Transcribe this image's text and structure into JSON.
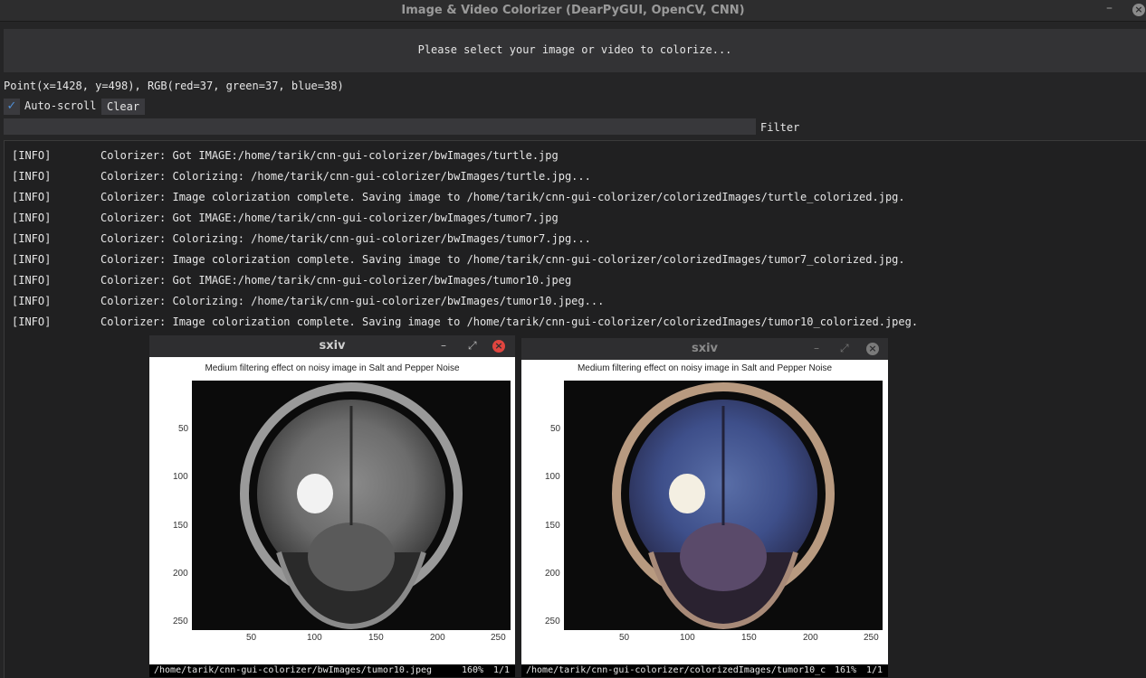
{
  "app": {
    "title": "Image & Video Colorizer (DearPyGUI, OpenCV, CNN)",
    "minimize": "–",
    "close": "×"
  },
  "banner": {
    "text": "Please select your image or video to colorize..."
  },
  "point_info": "Point(x=1428, y=498), RGB(red=37, green=37, blue=38)",
  "controls": {
    "autoscroll_checked": "✓",
    "autoscroll_label": "Auto-scroll",
    "clear_label": "Clear",
    "filter_label": "Filter",
    "filter_value": ""
  },
  "log": [
    {
      "level": "[INFO]",
      "msg": "Colorizer: Got IMAGE:/home/tarik/cnn-gui-colorizer/bwImages/turtle.jpg"
    },
    {
      "level": "[INFO]",
      "msg": "Colorizer: Colorizing: /home/tarik/cnn-gui-colorizer/bwImages/turtle.jpg..."
    },
    {
      "level": "[INFO]",
      "msg": "Colorizer: Image colorization complete. Saving image to /home/tarik/cnn-gui-colorizer/colorizedImages/turtle_colorized.jpg."
    },
    {
      "level": "[INFO]",
      "msg": "Colorizer: Got IMAGE:/home/tarik/cnn-gui-colorizer/bwImages/tumor7.jpg"
    },
    {
      "level": "[INFO]",
      "msg": "Colorizer: Colorizing: /home/tarik/cnn-gui-colorizer/bwImages/tumor7.jpg..."
    },
    {
      "level": "[INFO]",
      "msg": "Colorizer: Image colorization complete. Saving image to /home/tarik/cnn-gui-colorizer/colorizedImages/tumor7_colorized.jpg."
    },
    {
      "level": "[INFO]",
      "msg": "Colorizer: Got IMAGE:/home/tarik/cnn-gui-colorizer/bwImages/tumor10.jpeg"
    },
    {
      "level": "[INFO]",
      "msg": "Colorizer: Colorizing: /home/tarik/cnn-gui-colorizer/bwImages/tumor10.jpeg..."
    },
    {
      "level": "[INFO]",
      "msg": "Colorizer: Image colorization complete. Saving image to /home/tarik/cnn-gui-colorizer/colorizedImages/tumor10_colorized.jpeg."
    }
  ],
  "viewers": [
    {
      "title": "sxiv",
      "active": true,
      "minimize": "–",
      "maximize": "⤢",
      "close": "×",
      "plot_title": "Medium filtering effect on noisy image in Salt and Pepper Noise",
      "y_ticks": [
        "50",
        "100",
        "150",
        "200",
        "250"
      ],
      "x_ticks": [
        "50",
        "100",
        "150",
        "200",
        "250"
      ],
      "colorized": false,
      "status_path": "/home/tarik/cnn-gui-colorizer/bwImages/tumor10.jpeg",
      "status_zoom": "160%",
      "status_page": "1/1"
    },
    {
      "title": "sxiv",
      "active": false,
      "minimize": "–",
      "maximize": "⤢",
      "close": "×",
      "plot_title": "Medium filtering effect on noisy image in Salt and Pepper Noise",
      "y_ticks": [
        "50",
        "100",
        "150",
        "200",
        "250"
      ],
      "x_ticks": [
        "50",
        "100",
        "150",
        "200",
        "250"
      ],
      "colorized": true,
      "status_path": "/home/tarik/cnn-gui-colorizer/colorizedImages/tumor10_c",
      "status_zoom": "161%",
      "status_page": "1/1"
    }
  ],
  "colors": {
    "background": "#252526",
    "titlebar": "#2d2d2e",
    "banner": "#333335",
    "accent_check": "#4f8fd6",
    "close_active": "#e0453f"
  }
}
